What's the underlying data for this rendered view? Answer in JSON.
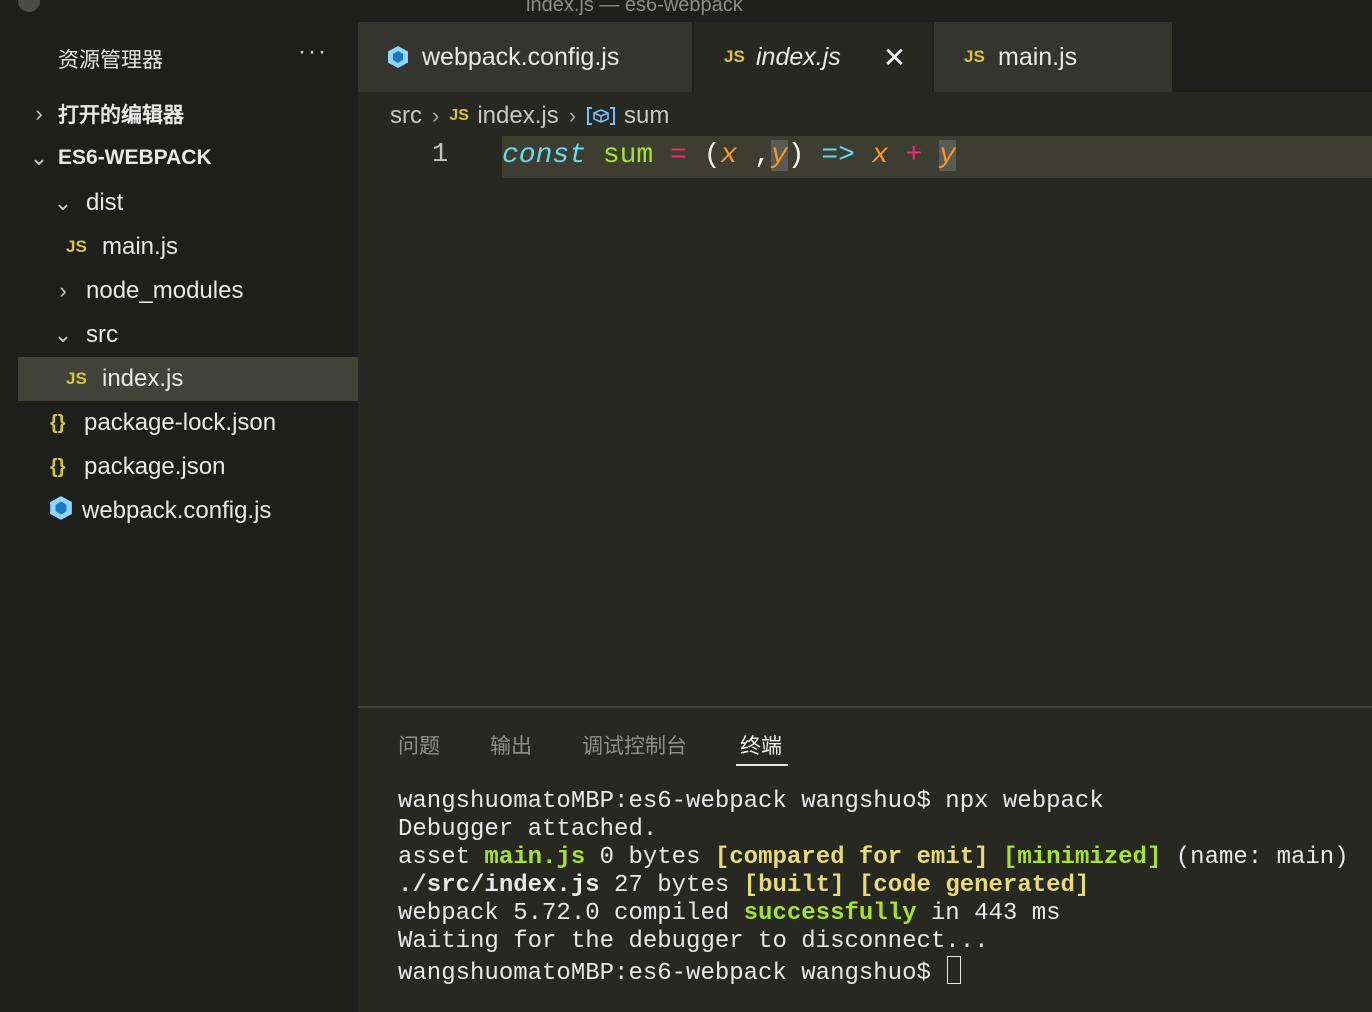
{
  "window": {
    "title": "index.js — es6-webpack"
  },
  "sidebar": {
    "header": "资源管理器",
    "more": "···",
    "open_editors": "打开的编辑器",
    "project": "ES6-WEBPACK",
    "items": [
      {
        "label": "dist",
        "kind": "folder-open"
      },
      {
        "label": "main.js",
        "kind": "js"
      },
      {
        "label": "node_modules",
        "kind": "folder-closed"
      },
      {
        "label": "src",
        "kind": "folder-open"
      },
      {
        "label": "index.js",
        "kind": "js",
        "selected": true
      },
      {
        "label": "package-lock.json",
        "kind": "json"
      },
      {
        "label": "package.json",
        "kind": "json"
      },
      {
        "label": "webpack.config.js",
        "kind": "webpack"
      }
    ]
  },
  "icons": {
    "js": "JS",
    "json": "{}"
  },
  "tabs": [
    {
      "label": "webpack.config.js",
      "icon": "webpack-cube-icon"
    },
    {
      "label": "index.js",
      "icon": "js-file-icon",
      "active": true,
      "close": "✕"
    },
    {
      "label": "main.js",
      "icon": "js-file-icon"
    }
  ],
  "breadcrumb": {
    "folder": "src",
    "file": "index.js",
    "symbol": "sum"
  },
  "editor": {
    "line_number": "1",
    "tokens": {
      "kw": "const",
      "name": "sum",
      "eq": "=",
      "open": "(",
      "x": "x",
      "comma": " ,",
      "y": "y",
      "close": ")",
      "arrow": "=>",
      "x2": "x",
      "plus": "+",
      "y2": "y"
    }
  },
  "panel": {
    "tabs": [
      "问题",
      "输出",
      "调试控制台",
      "终端"
    ],
    "active_tab": "终端",
    "terminal": {
      "l1": "wangshuomatoMBP:es6-webpack wangshuo$ npx webpack",
      "l2": "Debugger attached.",
      "l3_a": "asset ",
      "l3_b": "main.js",
      "l3_c": " 0 bytes ",
      "l3_d": "[compared for emit]",
      "l3_e": " ",
      "l3_f": "[minimized]",
      "l3_g": " (name: main)",
      "l4_a": "./src/index.js",
      "l4_b": " 27 bytes ",
      "l4_c": "[built]",
      "l4_d": " ",
      "l4_e": "[code generated]",
      "l5_a": "webpack 5.72.0 compiled ",
      "l5_b": "successfully",
      "l5_c": " in 443 ms",
      "l6": "Waiting for the debugger to disconnect...",
      "l7": "wangshuomatoMBP:es6-webpack wangshuo$ "
    }
  },
  "colors": {
    "keyword": "#66d9ef",
    "function": "#a6e22e",
    "operator": "#f92672",
    "param": "#fd971f",
    "js_icon": "#d6c53c"
  }
}
